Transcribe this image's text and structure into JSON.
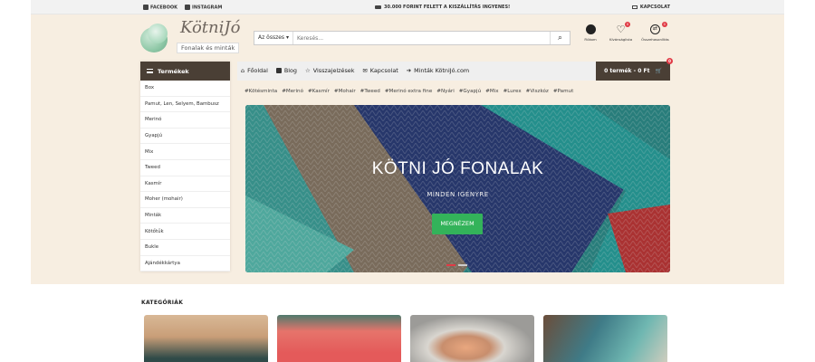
{
  "topbar": {
    "facebook": "FACEBOOK",
    "instagram": "INSTAGRAM",
    "shipping": "30.000 FORINT FELETT A KISZÁLLÍTÁS INGYENES!",
    "contact": "KAPCSOLAT"
  },
  "logo": {
    "title": "KötniJó",
    "subtitle": "Fonalak és minták"
  },
  "search": {
    "category": "Az összes",
    "placeholder": "Keresés..."
  },
  "header_icons": [
    {
      "name": "account-icon",
      "label": "Fiókom",
      "badge": ""
    },
    {
      "name": "heart-icon",
      "label": "Kívánságlista",
      "badge": "0"
    },
    {
      "name": "compare-icon",
      "label": "Összehasonlítás",
      "badge": "0"
    }
  ],
  "nav": {
    "items": [
      "Főoldal",
      "Blog",
      "Visszajelzések",
      "Kapcsolat",
      "Minták KötniJó.com"
    ],
    "cart": "0 termék - 0 Ft",
    "cart_badge": "0"
  },
  "sidebar": {
    "title": "Termékek",
    "items": [
      "Box",
      "Pamut, Len, Selyem, Bambusz",
      "Merinó",
      "Gyapjú",
      "Mix",
      "Tweed",
      "Kasmír",
      "Moher (mohair)",
      "Minták",
      "Kötőtűk",
      "Bukle",
      "Ajándékkártya"
    ]
  },
  "tags": [
    "#Kötésminta",
    "#Merinó",
    "#Kasmír",
    "#Mohair",
    "#Tweed",
    "#Merinó extra fine",
    "#Nyári",
    "#Gyapjú",
    "#Mix",
    "#Lurex",
    "#Viszkóz",
    "#Pamut"
  ],
  "hero": {
    "title": "KÖTNI JÓ FONALAK",
    "subtitle": "MINDEN IGÉNYRE",
    "button": "MEGNÉZEM"
  },
  "categories": {
    "title": "KATEGÓRIÁK"
  },
  "colors": {
    "brown": "#4a3f35",
    "beige": "#f7eee1",
    "green": "#33b35a",
    "red": "#e03a45"
  }
}
